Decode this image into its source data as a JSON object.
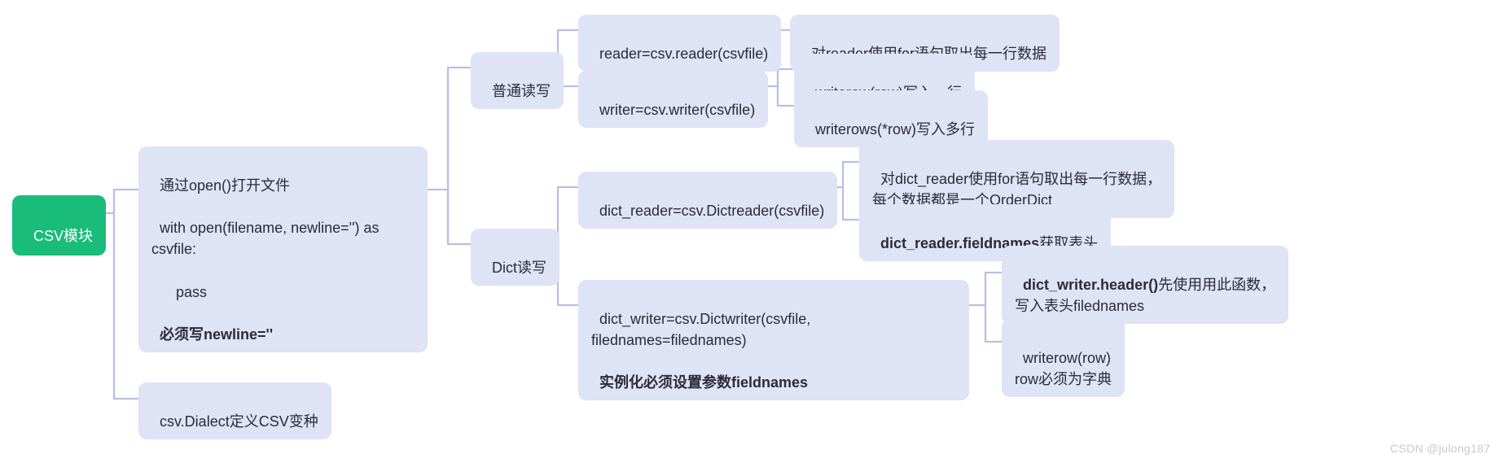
{
  "root": "CSV模块",
  "openBlock": {
    "l1": "通过open()打开文件",
    "l2": "with open(filename, newline='') as csvfile:",
    "l3": "    pass",
    "l4": "必须写newline=''"
  },
  "dialect": "csv.Dialect定义CSV变种",
  "normalRW": "普通读写",
  "dictRW": "Dict读写",
  "reader": "reader=csv.reader(csvfile)",
  "readerNote": "对reader使用for语句取出每一行数据",
  "writer": "writer=csv.writer(csvfile)",
  "writerow": "writerow(row)写入一行",
  "writerows": "writerows(*row)写入多行",
  "dictReader": "dict_reader=csv.Dictreader(csvfile)",
  "dictReaderNote": "对dict_reader使用for语句取出每一行数据，\n每个数据都是一个OrderDict",
  "dictReaderFieldnames_b": "dict_reader.fieldnames",
  "dictReaderFieldnames_t": "获取表头",
  "dictWriter_l1": "dict_writer=csv.Dictwriter(csvfile, filednames=filednames)",
  "dictWriter_l2": "实例化必须设置参数fieldnames",
  "dictWriterHeader_b": "dict_writer.header()",
  "dictWriterHeader_t": "先使用用此函数，\n写入表头filednames",
  "dictWriterRow": "writerow(row)\nrow必须为字典",
  "watermark": "CSDN @julong187"
}
